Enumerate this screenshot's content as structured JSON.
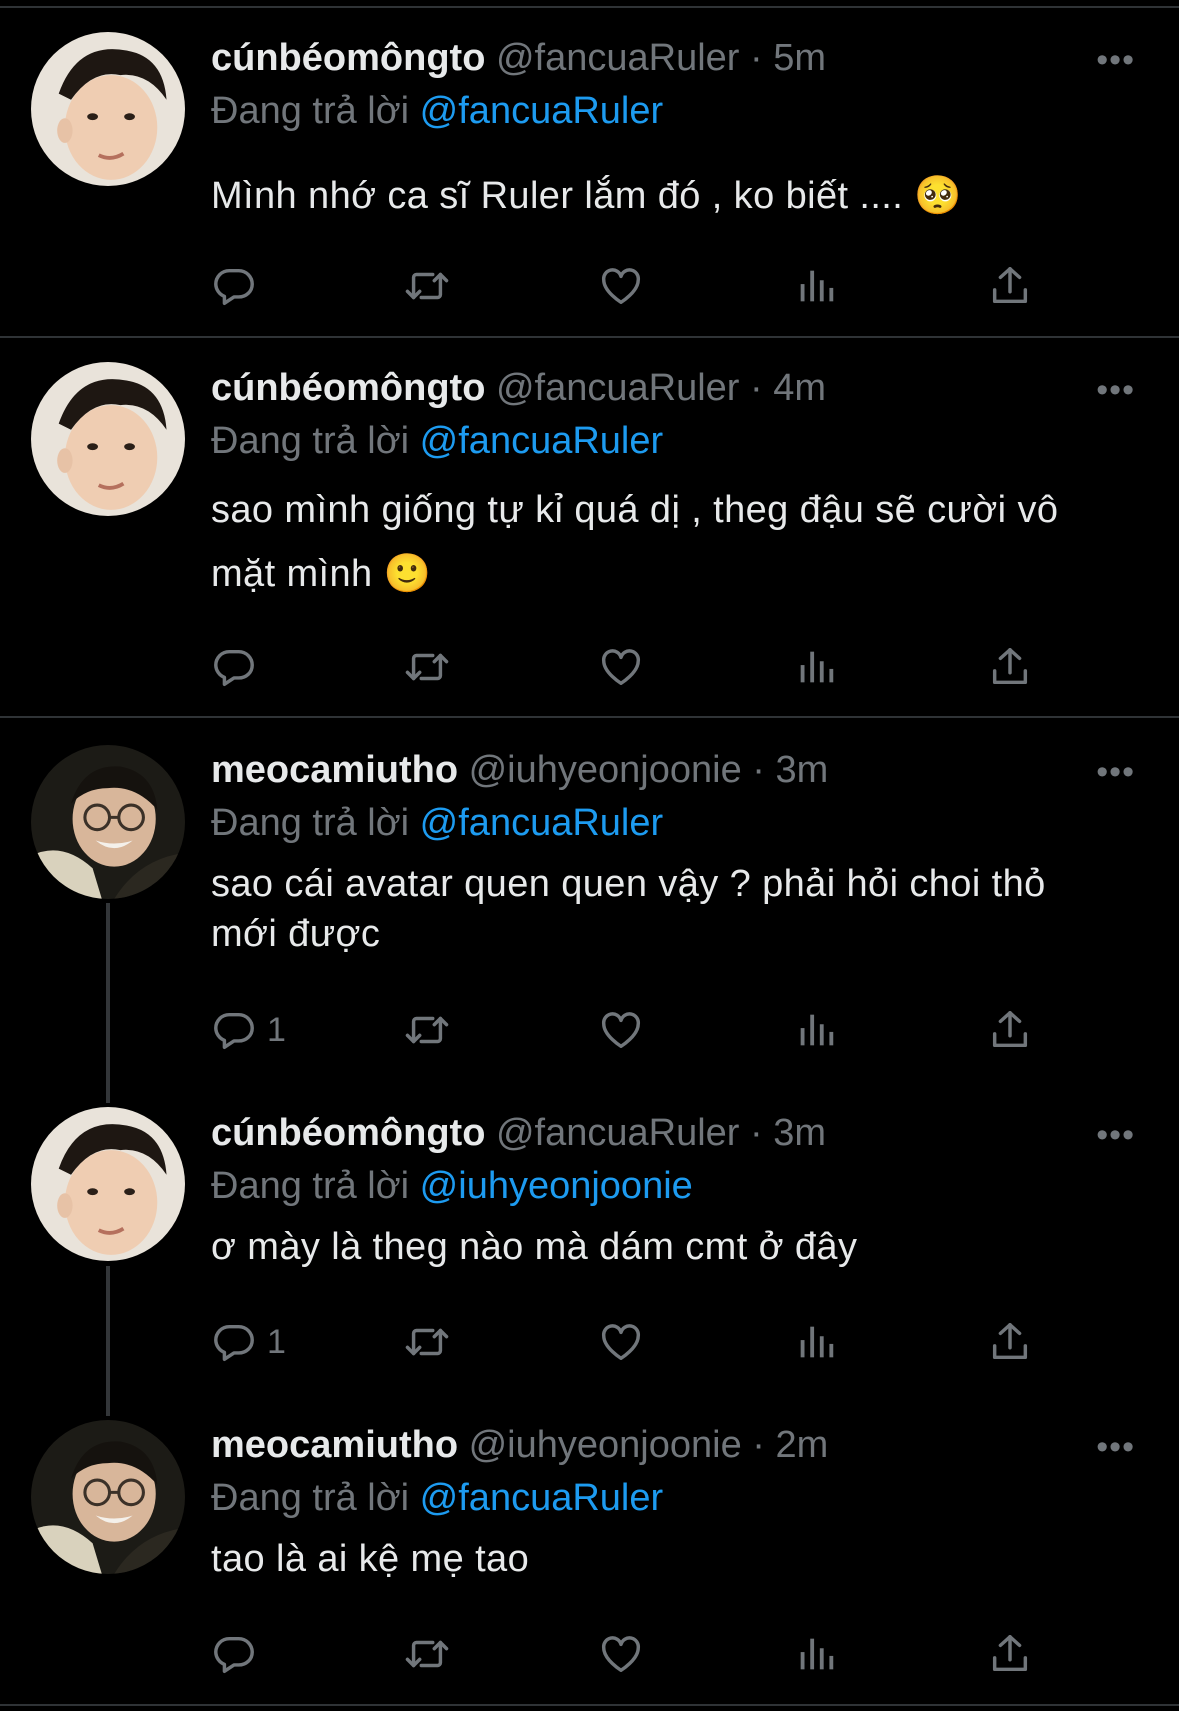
{
  "colors": {
    "background": "#000000",
    "text": "#e7e9ea",
    "muted": "#71767b",
    "link": "#1d9bf0"
  },
  "tweets": [
    {
      "name": "cúnbéomôngto",
      "handle": "@fancuaRuler",
      "sep": "·",
      "time": "5m",
      "replying_prefix": "Đang trả lời",
      "replying_to": "@fancuaRuler",
      "text": "Mình nhớ ca sĩ Ruler lắm đó , ko biết ....",
      "emoji": "🥺",
      "reply_count": "",
      "more": "•••",
      "avatar": "boy-avatar"
    },
    {
      "name": "cúnbéomôngto",
      "handle": "@fancuaRuler",
      "sep": "·",
      "time": "4m",
      "replying_prefix": "Đang trả lời",
      "replying_to": "@fancuaRuler",
      "text": "sao mình giống tự kỉ quá dị , theg đậu sẽ cười vô mặt mình",
      "emoji": "🙂",
      "reply_count": "",
      "more": "•••",
      "avatar": "boy-avatar"
    },
    {
      "name": "meocamiutho",
      "handle": "@iuhyeonjoonie",
      "sep": "·",
      "time": "3m",
      "replying_prefix": "Đang trả lời",
      "replying_to": "@fancuaRuler",
      "text": "sao cái avatar quen quen vậy ? phải hỏi choi thỏ mới được",
      "emoji": "",
      "reply_count": "1",
      "more": "•••",
      "avatar": "glasses-avatar"
    },
    {
      "name": "cúnbéomôngto",
      "handle": "@fancuaRuler",
      "sep": "·",
      "time": "3m",
      "replying_prefix": "Đang trả lời",
      "replying_to": "@iuhyeonjoonie",
      "text": "ơ mày là theg nào mà dám cmt ở đây",
      "emoji": "",
      "reply_count": "1",
      "more": "•••",
      "avatar": "boy-avatar"
    },
    {
      "name": "meocamiutho",
      "handle": "@iuhyeonjoonie",
      "sep": "·",
      "time": "2m",
      "replying_prefix": "Đang trả lời",
      "replying_to": "@fancuaRuler",
      "text": "tao là ai kệ mẹ tao",
      "emoji": "",
      "reply_count": "",
      "more": "•••",
      "avatar": "glasses-avatar"
    }
  ]
}
